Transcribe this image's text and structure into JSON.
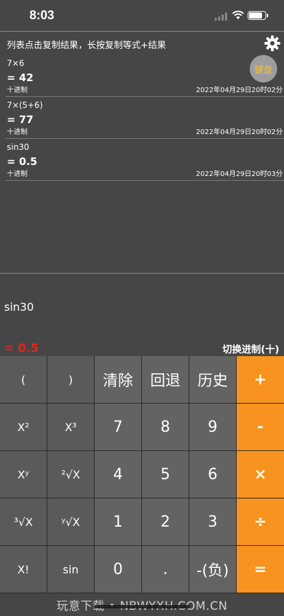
{
  "status": {
    "time": "8:03"
  },
  "hint": "列表点击复制结果，长按复制等式+结果",
  "keyboard_button": "键盘",
  "history": [
    {
      "expression": "7×6",
      "result": "= 42",
      "base": "十进制",
      "time": "2022年04月29日20时02分"
    },
    {
      "expression": "7×(5+6)",
      "result": "= 77",
      "base": "十进制",
      "time": "2022年04月29日20时02分"
    },
    {
      "expression": "sin30",
      "result": "= 0.5",
      "base": "十进制",
      "time": "2022年04月29日20时03分"
    }
  ],
  "display": {
    "expression": "sin30",
    "result": "= 0.5",
    "switch_base": "切换进制(十)"
  },
  "keys": [
    {
      "label": "(",
      "name": "key-open-paren",
      "kind": "fn"
    },
    {
      "label": ")",
      "name": "key-close-paren",
      "kind": "fn"
    },
    {
      "label": "清除",
      "name": "key-clear",
      "kind": "num"
    },
    {
      "label": "回退",
      "name": "key-backspace",
      "kind": "num"
    },
    {
      "label": "历史",
      "name": "key-history",
      "kind": "num"
    },
    {
      "label": "+",
      "name": "key-plus",
      "kind": "op"
    },
    {
      "label": "X²",
      "name": "key-square",
      "kind": "fn"
    },
    {
      "label": "X³",
      "name": "key-cube",
      "kind": "fn"
    },
    {
      "label": "7",
      "name": "key-7",
      "kind": "num"
    },
    {
      "label": "8",
      "name": "key-8",
      "kind": "num"
    },
    {
      "label": "9",
      "name": "key-9",
      "kind": "num"
    },
    {
      "label": "-",
      "name": "key-minus",
      "kind": "op"
    },
    {
      "label": "Xʸ",
      "name": "key-power",
      "kind": "fn"
    },
    {
      "label": "²√X",
      "name": "key-sqrt",
      "kind": "fn"
    },
    {
      "label": "4",
      "name": "key-4",
      "kind": "num"
    },
    {
      "label": "5",
      "name": "key-5",
      "kind": "num"
    },
    {
      "label": "6",
      "name": "key-6",
      "kind": "num"
    },
    {
      "label": "×",
      "name": "key-multiply",
      "kind": "op"
    },
    {
      "label": "³√X",
      "name": "key-cbrt",
      "kind": "fn"
    },
    {
      "label": "ʸ√X",
      "name": "key-nth-root",
      "kind": "fn"
    },
    {
      "label": "1",
      "name": "key-1",
      "kind": "num"
    },
    {
      "label": "2",
      "name": "key-2",
      "kind": "num"
    },
    {
      "label": "3",
      "name": "key-3",
      "kind": "num"
    },
    {
      "label": "÷",
      "name": "key-divide",
      "kind": "op"
    },
    {
      "label": "X!",
      "name": "key-factorial",
      "kind": "fn"
    },
    {
      "label": "sin",
      "name": "key-sin",
      "kind": "fn"
    },
    {
      "label": "0",
      "name": "key-0",
      "kind": "num"
    },
    {
      "label": ".",
      "name": "key-decimal",
      "kind": "num"
    },
    {
      "label": "-(负)",
      "name": "key-negate",
      "kind": "num"
    },
    {
      "label": "=",
      "name": "key-equals",
      "kind": "op"
    }
  ],
  "watermark": "玩意下载 • NBWYXH.COM.CN",
  "colors": {
    "background": "#464646",
    "operator": "#f7931e",
    "result_red": "#e0271a",
    "keyboard_text": "#f1c040"
  }
}
